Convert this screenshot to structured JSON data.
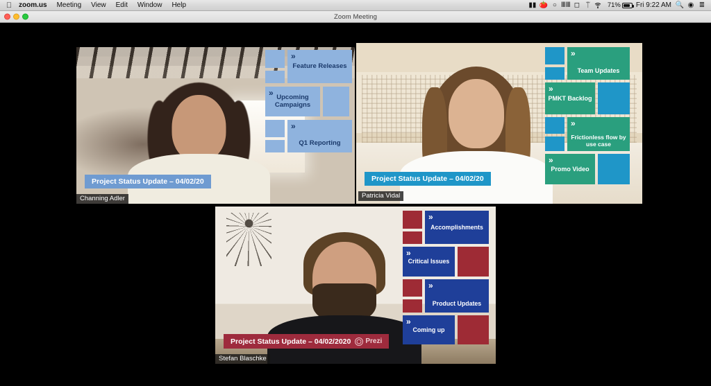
{
  "menubar": {
    "apple_icon": "apple-icon",
    "items": [
      {
        "label": "zoom.us",
        "bold": true
      },
      {
        "label": "Meeting",
        "bold": false
      },
      {
        "label": "View",
        "bold": false
      },
      {
        "label": "Edit",
        "bold": false
      },
      {
        "label": "Window",
        "bold": false
      },
      {
        "label": "Help",
        "bold": false
      }
    ],
    "status_icons": [
      "screen-recorder-icon",
      "evernote-icon",
      "sync-icon",
      "equalizer-icon",
      "airplay-icon",
      "bluetooth-icon"
    ],
    "wifi_icon": "wifi-icon",
    "battery_percent": "71%",
    "battery_icon": "battery-icon",
    "clock": "Fri 9:22 AM",
    "search_icon": "spotlight-search-icon",
    "siri_icon": "siri-icon",
    "control_center_icon": "notification-center-icon"
  },
  "window": {
    "title": "Zoom Meeting",
    "close_label": "close",
    "minimize_label": "minimize",
    "maximize_label": "maximize"
  },
  "meeting": {
    "layout": "gallery-view",
    "participants": [
      {
        "name": "Channing Adler",
        "active_speaker": false,
        "banner_text": "Project Status Update – 04/02/20",
        "banner_color": "#6f9bd1",
        "card_color": "#6f9bd1",
        "square_color": "#8fb3de",
        "text_color": "#1b3a6b",
        "has_prezi_logo": false,
        "cards": [
          {
            "label": "Feature Releases"
          },
          {
            "label": "Upcoming Campaigns"
          },
          {
            "label": "Q1 Reporting"
          }
        ]
      },
      {
        "name": "Patricia Vidal",
        "active_speaker": true,
        "active_border_color": "#d6ec4b",
        "banner_text": "Project Status Update – 04/02/20",
        "banner_color": "#1f96c8",
        "card_color": "#2a9f7e",
        "square_color": "#1f96c8",
        "text_color": "#ffffff",
        "has_prezi_logo": false,
        "cards": [
          {
            "label": "Team Updates"
          },
          {
            "label": "PMKT Backlog"
          },
          {
            "label": "Frictionless flow by use case"
          },
          {
            "label": "Promo Video"
          }
        ]
      },
      {
        "name": "Stefan Blaschke",
        "active_speaker": false,
        "banner_text": "Project Status Update – 04/02/2020",
        "banner_color": "#9e2b3d",
        "card_color": "#1f3f99",
        "square_color": "#9e2b35",
        "text_color": "#ffffff",
        "has_prezi_logo": true,
        "prezi_label": "Prezi",
        "cards": [
          {
            "label": "Accomplishments"
          },
          {
            "label": "Critical Issues"
          },
          {
            "label": "Product Updates"
          },
          {
            "label": "Coming up"
          }
        ]
      }
    ],
    "chevron_glyph": "»"
  }
}
